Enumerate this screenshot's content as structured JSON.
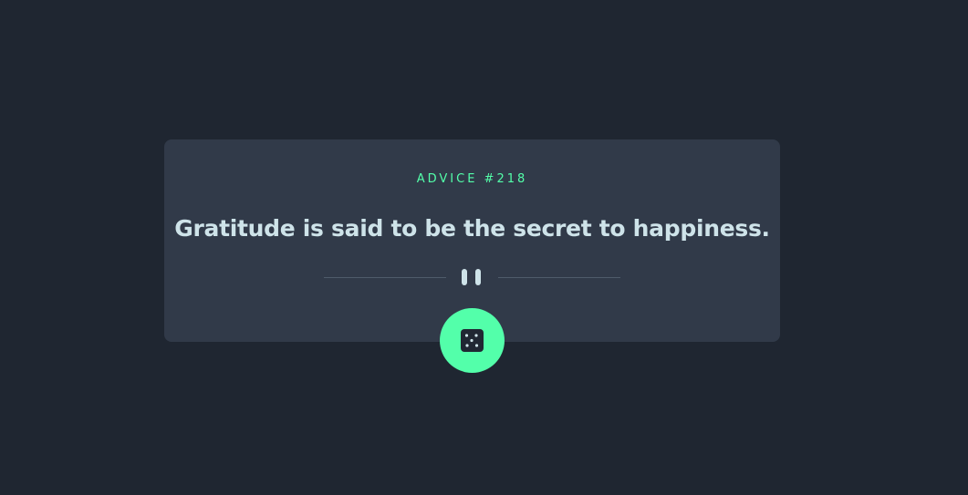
{
  "advice": {
    "number_label": "ADVICE #218",
    "text": "Gratitude is said to be the secret to happiness."
  },
  "icons": {
    "divider": "pause-icon",
    "button": "dice-icon"
  },
  "colors": {
    "background": "#1f2631",
    "card": "#313a49",
    "accent": "#53ffaa",
    "text": "#cee3e9"
  }
}
